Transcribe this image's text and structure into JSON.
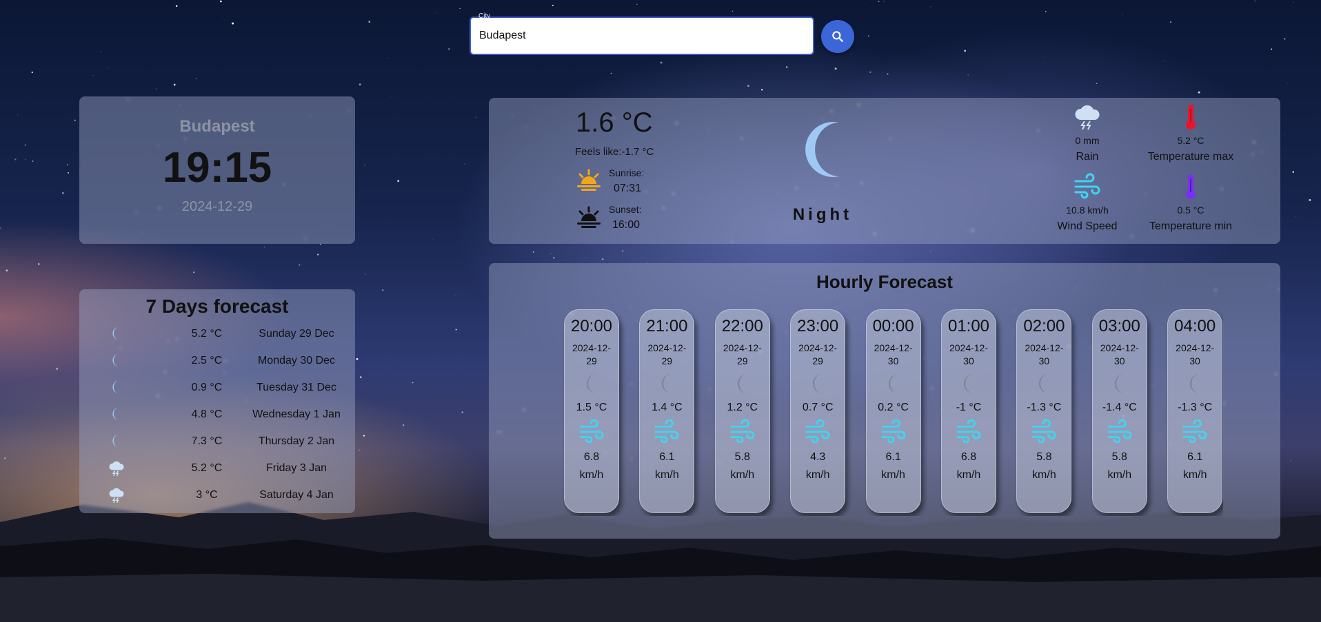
{
  "search": {
    "legend": "City",
    "value": "Budapest",
    "button_icon": "search-icon"
  },
  "location": {
    "city": "Budapest",
    "time": "19:15",
    "date": "2024-12-29"
  },
  "current": {
    "temperature": "1.6 °C",
    "feels_like": "Feels like:-1.7 °C",
    "sunrise_label": "Sunrise:",
    "sunrise_time": "07:31",
    "sunset_label": "Sunset:",
    "sunset_time": "16:00",
    "condition_icon": "moon-icon",
    "condition": "Night",
    "rain_value": "0 mm",
    "rain_label": "Rain",
    "temp_max_value": "5.2 °C",
    "temp_max_label": "Temperature max",
    "wind_value": "10.8 km/h",
    "wind_label": "Wind Speed",
    "temp_min_value": "0.5 °C",
    "temp_min_label": "Temperature min"
  },
  "weekly": {
    "title": "7 Days forecast",
    "days": [
      {
        "icon": "moon-icon",
        "temp": "5.2 °C",
        "day": "Sunday 29 Dec"
      },
      {
        "icon": "moon-icon",
        "temp": "2.5 °C",
        "day": "Monday 30 Dec"
      },
      {
        "icon": "moon-icon",
        "temp": "0.9 °C",
        "day": "Tuesday 31 Dec"
      },
      {
        "icon": "moon-icon",
        "temp": "4.8 °C",
        "day": "Wednesday 1 Jan"
      },
      {
        "icon": "moon-icon",
        "temp": "7.3 °C",
        "day": "Thursday 2 Jan"
      },
      {
        "icon": "storm-cloud-icon",
        "temp": "5.2 °C",
        "day": "Friday 3 Jan"
      },
      {
        "icon": "storm-cloud-icon",
        "temp": "3 °C",
        "day": "Saturday 4 Jan"
      }
    ]
  },
  "hourly": {
    "title": "Hourly Forecast",
    "hours": [
      {
        "time": "20:00",
        "date": "2024-12-29",
        "temp": "1.5 °C",
        "speed": "6.8",
        "unit": "km/h"
      },
      {
        "time": "21:00",
        "date": "2024-12-29",
        "temp": "1.4 °C",
        "speed": "6.1",
        "unit": "km/h"
      },
      {
        "time": "22:00",
        "date": "2024-12-29",
        "temp": "1.2 °C",
        "speed": "5.8",
        "unit": "km/h"
      },
      {
        "time": "23:00",
        "date": "2024-12-29",
        "temp": "0.7 °C",
        "speed": "4.3",
        "unit": "km/h"
      },
      {
        "time": "00:00",
        "date": "2024-12-30",
        "temp": "0.2 °C",
        "speed": "6.1",
        "unit": "km/h"
      },
      {
        "time": "01:00",
        "date": "2024-12-30",
        "temp": "-1 °C",
        "speed": "6.8",
        "unit": "km/h"
      },
      {
        "time": "02:00",
        "date": "2024-12-30",
        "temp": "-1.3 °C",
        "speed": "5.8",
        "unit": "km/h"
      },
      {
        "time": "03:00",
        "date": "2024-12-30",
        "temp": "-1.4 °C",
        "speed": "5.8",
        "unit": "km/h"
      },
      {
        "time": "04:00",
        "date": "2024-12-30",
        "temp": "-1.3 °C",
        "speed": "6.1",
        "unit": "km/h"
      }
    ]
  },
  "colors": {
    "accent": "#3c66d8",
    "moon": "#9ec9f5",
    "wind": "#3fd6f0",
    "thermo_max": "#e8162b",
    "thermo_min": "#7b2ff0",
    "sunrise": "#f2a71b"
  }
}
